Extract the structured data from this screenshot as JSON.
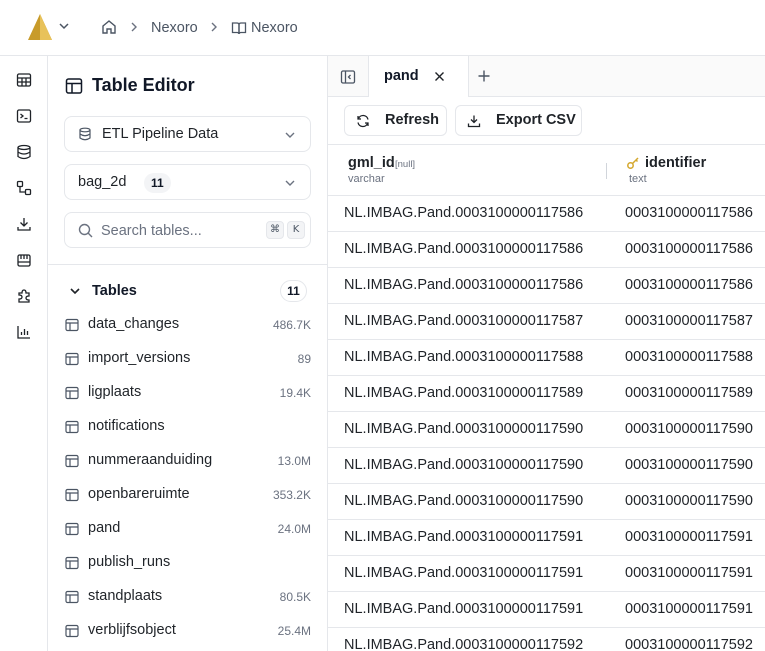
{
  "breadcrumb": {
    "org": "Nexoro",
    "project": "Nexoro"
  },
  "colors": {
    "accent": "#d4a72c",
    "border": "#e5e7eb",
    "muted": "#6b7280"
  },
  "sidebar": {
    "title": "Table Editor",
    "database_select": "ETL Pipeline Data",
    "schema_select": "bag_2d",
    "schema_count": "11",
    "search": {
      "placeholder": "Search tables...",
      "shortcut_keys": [
        "⌘",
        "K"
      ]
    },
    "tables_label": "Tables",
    "tables_count": "11",
    "tables": [
      {
        "name": "data_changes",
        "count": "486.7K"
      },
      {
        "name": "import_versions",
        "count": "89"
      },
      {
        "name": "ligplaats",
        "count": "19.4K"
      },
      {
        "name": "notifications",
        "count": ""
      },
      {
        "name": "nummeraanduiding",
        "count": "13.0M"
      },
      {
        "name": "openbareruimte",
        "count": "353.2K"
      },
      {
        "name": "pand",
        "count": "24.0M"
      },
      {
        "name": "publish_runs",
        "count": ""
      },
      {
        "name": "standplaats",
        "count": "80.5K"
      },
      {
        "name": "verblijfsobject",
        "count": "25.4M"
      }
    ]
  },
  "rail_icons": [
    "table-icon",
    "terminal-icon",
    "database-icon",
    "diagram-icon",
    "download-icon",
    "storage-icon",
    "plugin-icon",
    "chart-icon"
  ],
  "tabs": [
    {
      "label": "pand"
    }
  ],
  "toolbar": {
    "refresh_label": "Refresh",
    "export_label": "Export CSV"
  },
  "grid": {
    "columns": [
      {
        "name": "gml_id",
        "nullable_tag": "[null]",
        "type": "varchar"
      },
      {
        "name": "identifier",
        "type": "text",
        "key": true
      }
    ],
    "rows": [
      [
        "NL.IMBAG.Pand.0003100000117586",
        "0003100000117586"
      ],
      [
        "NL.IMBAG.Pand.0003100000117586",
        "0003100000117586"
      ],
      [
        "NL.IMBAG.Pand.0003100000117586",
        "0003100000117586"
      ],
      [
        "NL.IMBAG.Pand.0003100000117587",
        "0003100000117587"
      ],
      [
        "NL.IMBAG.Pand.0003100000117588",
        "0003100000117588"
      ],
      [
        "NL.IMBAG.Pand.0003100000117589",
        "0003100000117589"
      ],
      [
        "NL.IMBAG.Pand.0003100000117590",
        "0003100000117590"
      ],
      [
        "NL.IMBAG.Pand.0003100000117590",
        "0003100000117590"
      ],
      [
        "NL.IMBAG.Pand.0003100000117590",
        "0003100000117590"
      ],
      [
        "NL.IMBAG.Pand.0003100000117591",
        "0003100000117591"
      ],
      [
        "NL.IMBAG.Pand.0003100000117591",
        "0003100000117591"
      ],
      [
        "NL.IMBAG.Pand.0003100000117591",
        "0003100000117591"
      ],
      [
        "NL.IMBAG.Pand.0003100000117592",
        "0003100000117592"
      ]
    ]
  }
}
